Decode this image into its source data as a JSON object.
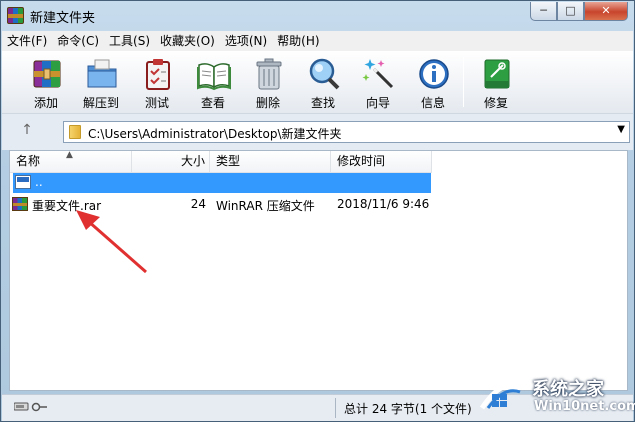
{
  "window": {
    "title": "新建文件夹",
    "controls": {
      "minimize": "─",
      "maximize": "□",
      "close": "✕"
    }
  },
  "menu": [
    "文件(F)",
    "命令(C)",
    "工具(S)",
    "收藏夹(O)",
    "选项(N)",
    "帮助(H)"
  ],
  "toolbar": {
    "add": "添加",
    "extract": "解压到",
    "test": "测试",
    "view": "查看",
    "delete": "删除",
    "find": "查找",
    "wizard": "向导",
    "info": "信息",
    "repair": "修复"
  },
  "address": {
    "path": "C:\\Users\\Administrator\\Desktop\\新建文件夹",
    "up": "↑",
    "dropdown": "▼"
  },
  "columns": {
    "name": "名称",
    "size": "大小",
    "type": "类型",
    "modified": "修改时间",
    "sort_indicator": "▲"
  },
  "rows": [
    {
      "name": "..",
      "size": "",
      "type": "",
      "modified": "",
      "selected": true
    },
    {
      "name": "重要文件.rar",
      "size": "24",
      "type": "WinRAR 压缩文件",
      "modified": "2018/11/6 9:46",
      "selected": false
    }
  ],
  "status": {
    "summary": "总计 24 字节(1 个文件)"
  },
  "watermark": {
    "brand": "系统之家",
    "url": "Win10net.com"
  },
  "colors": {
    "selection": "#3399ff",
    "annotation_arrow": "#e03030"
  }
}
